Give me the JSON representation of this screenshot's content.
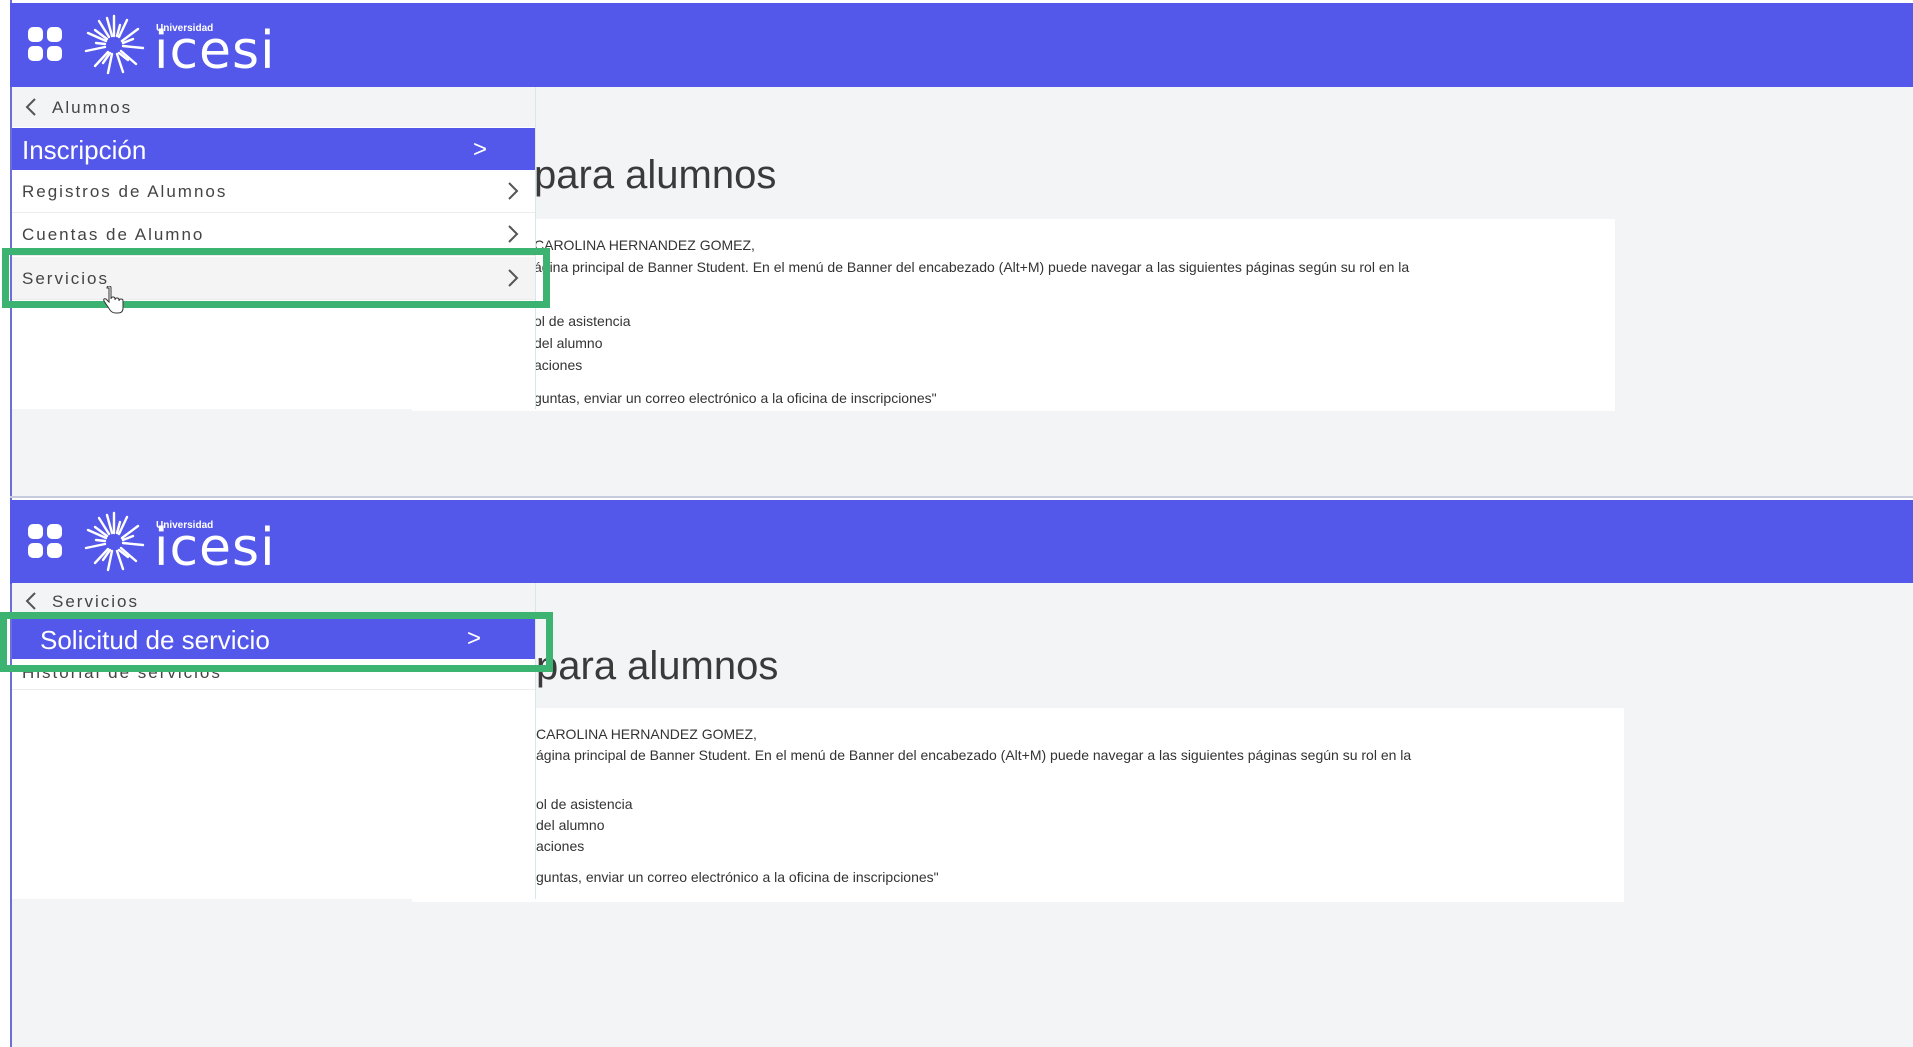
{
  "brand": {
    "logo_small": "Universidad",
    "logo_text": "icesi",
    "header_color": "#5458ea",
    "highlight_color": "#3cb371"
  },
  "screen1": {
    "back_label": "Alumnos",
    "active_item": {
      "label": "Inscripción",
      "arrow": ">"
    },
    "items": [
      {
        "label": "Registros de Alumnos"
      },
      {
        "label": "Cuentas de Alumno"
      },
      {
        "label": "Servicios"
      }
    ],
    "content": {
      "heading": "para alumnos",
      "lines": [
        "CAROLINA HERNANDEZ GOMEZ,",
        "ágina principal de Banner Student. En el menú de Banner del encabezado (Alt+M) puede navegar a las siguientes páginas según su rol en la",
        "ol de asistencia",
        "del alumno",
        "aciones",
        "guntas, enviar un correo electrónico a la oficina de inscripciones\""
      ]
    }
  },
  "screen2": {
    "back_label": "Servicios",
    "active_item": {
      "label": "Solicitud de servicio",
      "arrow": ">"
    },
    "items": [
      {
        "label": "Historial de servicios"
      }
    ],
    "content": {
      "heading": "para alumnos",
      "lines": [
        "CAROLINA HERNANDEZ GOMEZ,",
        "ágina principal de Banner Student. En el menú de Banner del encabezado (Alt+M) puede navegar a las siguientes páginas según su rol en la",
        "ol de asistencia",
        "del alumno",
        "aciones",
        "guntas, enviar un correo electrónico a la oficina de inscripciones\""
      ]
    }
  }
}
